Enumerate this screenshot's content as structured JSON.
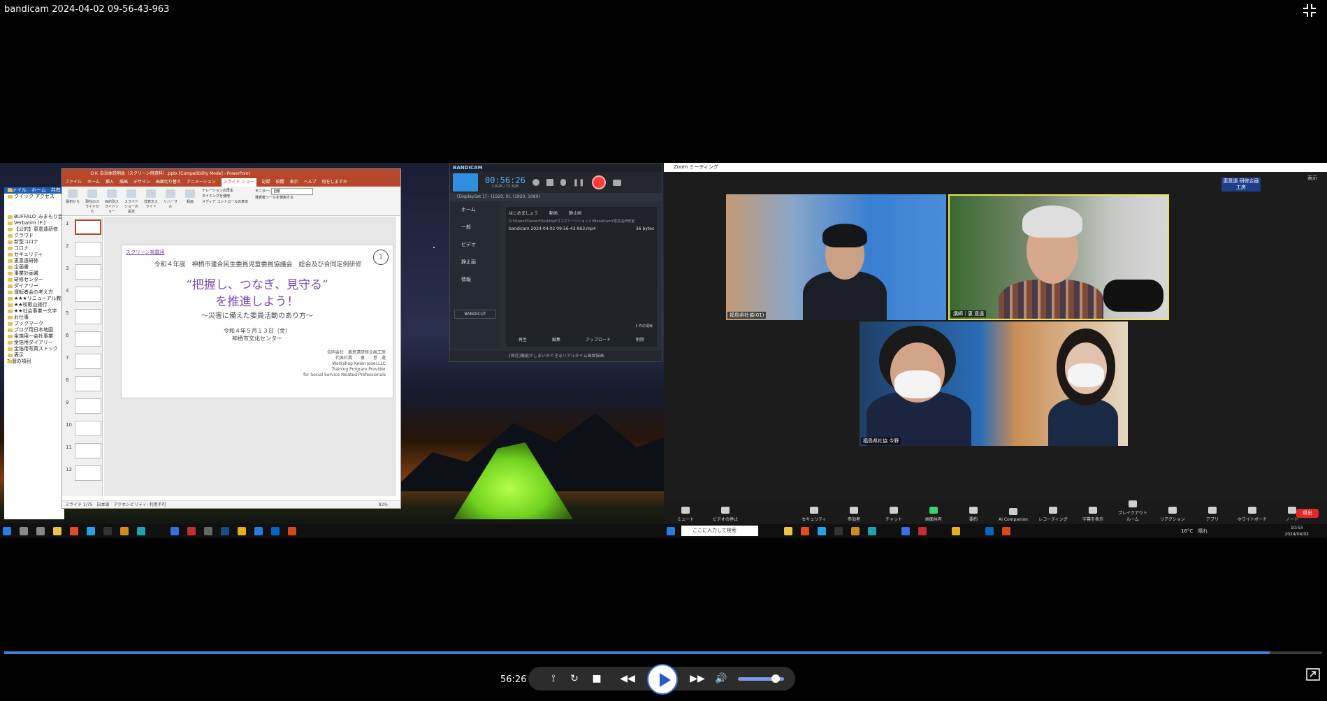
{
  "player": {
    "title": "bandicam 2024-04-02 09-56-43-963",
    "time": "56:26",
    "progress_pct": 96,
    "volume_pct": 82,
    "icons": [
      "exit-fullscreen-icon",
      "ab-repeat-icon",
      "loop-icon",
      "stop-icon",
      "rewind-icon",
      "play-icon",
      "forward-icon",
      "volume-icon",
      "popout-icon"
    ]
  },
  "powerpoint": {
    "title": "ＯＫ 自治体説明会（スクリーン用資料）.pptx [Compatibility Mode] - PowerPoint",
    "tabs": [
      "ファイル",
      "ホーム",
      "挿入",
      "描画",
      "デザイン",
      "画面切り替え",
      "アニメーション",
      "スライド ショー",
      "記録",
      "校閲",
      "表示",
      "ヘルプ",
      "何をしますか"
    ],
    "active_tab": "スライド ショー",
    "ribbon": [
      "最初から",
      "現在のスライドから",
      "目的別スライドショー",
      "スライドショーの設定",
      "非表示スライド",
      "リハーサル",
      "録画"
    ],
    "monitor_label": "モニター:",
    "monitor_value": "自動",
    "options": [
      "ナレーションの再生",
      "タイミングを使用",
      "メディア コントロールの表示",
      "発表者ツールを使用する"
    ],
    "slide": {
      "tag": "スクリーン掲載用",
      "subtitle": "令和４年度　神栖市連合民生委員児童委員協議会　総会及び合同定例研修",
      "page_no": "1",
      "heading1": "“把握し、つなぎ、見守る”",
      "heading2": "を推進しよう！",
      "heading3": "～災害に備えた委員活動のあり方～",
      "date": "令和４年５月１３日（金）",
      "venue": "神栖市文化センター",
      "org_line1": "合同会社　恵意遠研修企画工房",
      "org_line2": "代表社員　　恵　　意　遠",
      "org_line3": "Workshop Keien Josei,LLC",
      "org_line4": "Training Program Provider",
      "org_line5": "for Social Service Related Professionals"
    },
    "thumb_numbers": [
      "1",
      "2",
      "3",
      "4",
      "5",
      "6",
      "7",
      "8",
      "9",
      "10",
      "11",
      "12"
    ],
    "status": "スライド 1/75　日本語　アクセシビリティ: 利用不可",
    "zoom": "82%"
  },
  "explorer": {
    "items": [
      "ファイル",
      "ホーム",
      "共有",
      "表示",
      "クイック アクセス",
      "BUFFALO_みまもり会議",
      "Verbatim (F:)",
      "【公的】恵意遠研修",
      "クラウド",
      "新型コロナ",
      "コロナ",
      "セキュリティ",
      "恵意遠研修",
      "企画書",
      "事業計画書",
      "研修センター",
      "ダイアリー",
      "運転者会の考え方",
      "★★★リニューアル教科",
      "★★校歌山旅行",
      "★★社会事業一文字",
      "お仕事",
      "ブックマーク",
      "ブログ用日本地図",
      "金箔用一会社事業",
      "金箔用ダイアリー",
      "金箔用写真ストック"
    ],
    "count": "2 個の項目"
  },
  "bandicam": {
    "brand": "BANDICAM",
    "time": "00:56:26",
    "size": "1.6GB / 72.3GB",
    "screen": "[DisplaySet 1] - (1920, 0), (1920, 1080)",
    "nav": [
      "ホーム",
      "一般",
      "ビデオ",
      "静止画",
      "情報"
    ],
    "tabs": [
      "はじめましょう",
      "動画",
      "静止画"
    ],
    "path": "D:¥Users¥Owner¥Desktop¥オスクリーンショット¥Bandicam¥恵意遠研修室",
    "file_name": "bandicam 2024-04-02 09-56-43-963.mp4",
    "file_size": "36 bytes",
    "count": "1 件の項目",
    "actions": [
      "再生",
      "編集",
      "アップロード",
      "削除"
    ],
    "bandicut": "BANDICUT",
    "footer": "[保存]機能がしまいのできるリアルタイム画面描画",
    "colors": {
      "accent": "#2f8fe0",
      "record": "#ff3b3b"
    }
  },
  "zoom": {
    "title": "Zoom ミーティング",
    "view_label": "表示",
    "badge": "恵意遠 研修企画工房",
    "participants": [
      {
        "name": "福島県社協(01)"
      },
      {
        "name": "講師｜恵 意遠"
      },
      {
        "name": "福島県社協 今野"
      }
    ],
    "toolbar": [
      "ミュート",
      "ビデオの停止",
      "セキュリティ",
      "参加者",
      "チャット",
      "画面共有",
      "要約",
      "AI Companion",
      "レコーディング",
      "字幕を表示",
      "ブレイクアウトルーム",
      "リアクション",
      "アプリ",
      "ホワイトボード",
      "ノート"
    ],
    "end_label": "退出"
  },
  "taskbar": {
    "search_placeholder": "ここに入力して検索",
    "weather": "16°C　晴れ",
    "clock_time": "10:53",
    "clock_date": "2024/04/02"
  }
}
